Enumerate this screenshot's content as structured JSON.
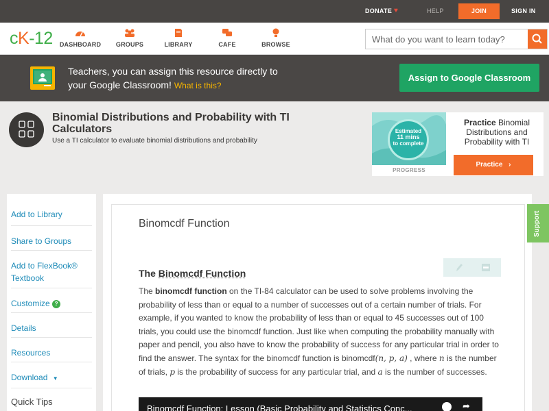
{
  "topbar": {
    "donate": "DONATE",
    "help": "HELP",
    "join": "JOIN",
    "signin": "SIGN IN"
  },
  "logo": {
    "c": "c",
    "k": "K",
    "n": "-12"
  },
  "nav": {
    "items": [
      {
        "label": "DASHBOARD",
        "icon": "dashboard-icon"
      },
      {
        "label": "GROUPS",
        "icon": "groups-icon"
      },
      {
        "label": "LIBRARY",
        "icon": "library-icon"
      },
      {
        "label": "CAFE",
        "icon": "cafe-icon"
      },
      {
        "label": "BROWSE",
        "icon": "browse-icon"
      }
    ]
  },
  "search": {
    "placeholder": "What do you want to learn today?"
  },
  "teacher_banner": {
    "line1": "Teachers, you can assign this resource directly to",
    "line2": "your Google Classroom!",
    "what_is": "What is this?",
    "assign_label": "Assign to Google Classroom"
  },
  "concept": {
    "title": "Binomial Distributions and Probability with TI Calculators",
    "subtitle": "Use a TI calculator to evaluate binomial distributions and probability"
  },
  "practice": {
    "estimated": "Estimated",
    "mins": "11 mins",
    "to_complete": "to complete",
    "progress": "PROGRESS",
    "title_bold": "Practice",
    "title_rest": "Binomial Distributions and Probability with TI",
    "button": "Practice"
  },
  "sidebar": {
    "items": [
      "Add to Library",
      "Share to Groups",
      "Add to FlexBook® Textbook",
      "Customize",
      "Details",
      "Resources",
      "Download"
    ],
    "quick_tips": "Quick Tips"
  },
  "content": {
    "title": "Binomcdf Function",
    "section_head_pre": "The ",
    "section_head_term": "Binomcdf Function",
    "p_intro": "The ",
    "p_bold": "binomcdf function",
    "p_rest": " on the TI-84 calculator can be used to solve problems involving the probability of less than or equal to a number of successes out of a certain number of trials. For example, if you wanted to know the probability of less than or equal to 45 successes out of 100 trials, you could use the binomcdf function. Just like when computing the probability manually with paper and pencil, you also have to know the probability of success for any particular trial in order to find the answer. The syntax for the binomcdf function is binomcdf",
    "math_args": "(n, p, a)",
    "p_where": " , where ",
    "math_n": "n",
    "p_is": " is the number of trials, ",
    "math_p": "p",
    "p_is2": " is the probability of success for any particular trial, and ",
    "math_a": "a",
    "p_end": " is the number of successes."
  },
  "video": {
    "title": "Binomcdf Function: Lesson (Basic Probability and Statistics Conc..."
  },
  "support": {
    "label": "Support"
  },
  "colors": {
    "accent": "#f26c2a",
    "brand_green": "#3fae49",
    "classroom_green": "#1fa463",
    "link": "#1e8bb8"
  }
}
